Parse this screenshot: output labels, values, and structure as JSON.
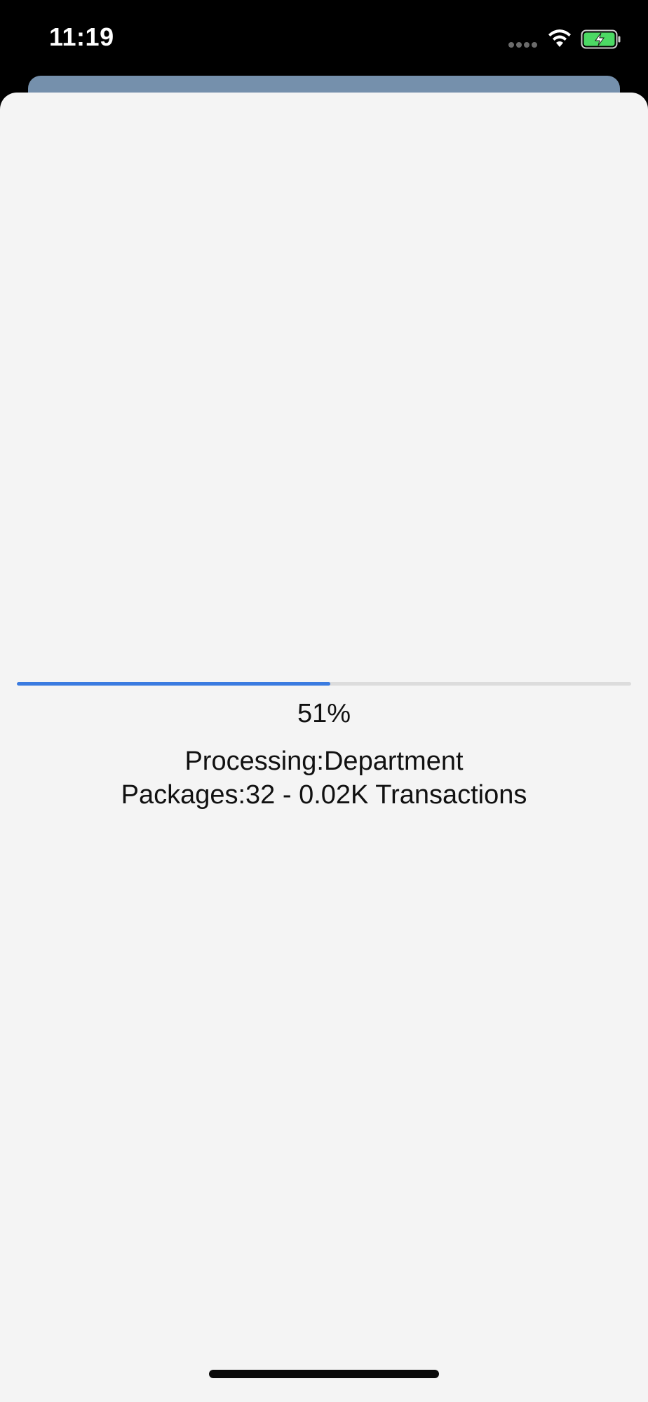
{
  "status_bar": {
    "time": "11:19",
    "icons": [
      "signal-icon",
      "wifi-icon",
      "battery-charging-icon"
    ]
  },
  "colors": {
    "progress_fill": "#3a7be0",
    "progress_track": "#dcdcdc",
    "background_card": "#7590ac",
    "sheet_background": "#f4f4f4"
  },
  "progress": {
    "value": 0.51,
    "percent_label": "51%",
    "processing_line": "Processing:Department",
    "detail_line": "Packages:32 - 0.02K Transactions"
  }
}
